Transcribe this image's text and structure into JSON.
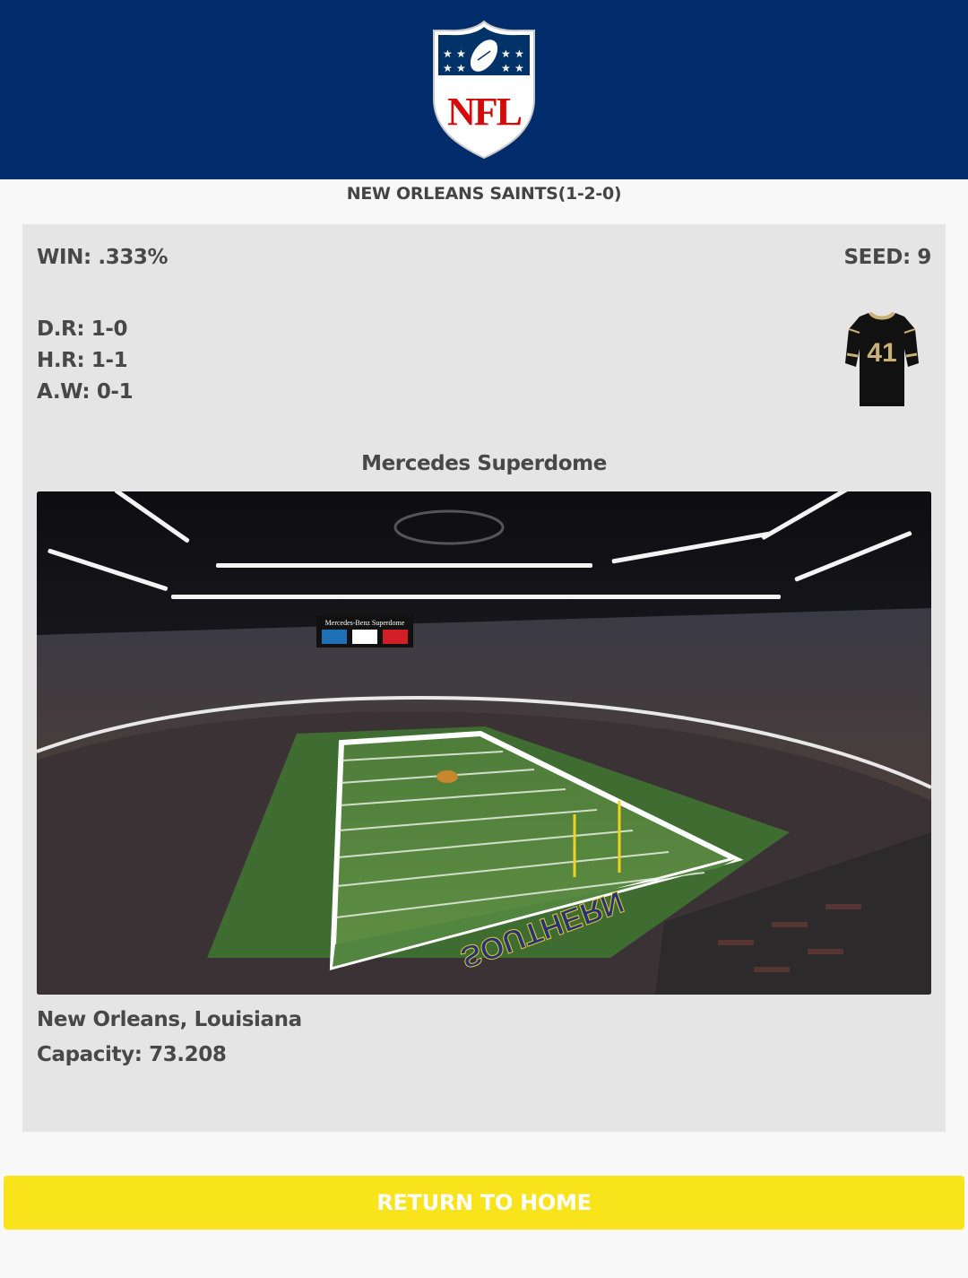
{
  "header": {
    "logo_text": "NFL",
    "primary_color": "#012c6b"
  },
  "team": {
    "title": "NEW ORLEANS SAINTS(1-2-0)",
    "win": "WIN: .333%",
    "seed": "SEED: 9",
    "division_record": "D.R: 1-0",
    "home_record": "H.R: 1-1",
    "away_record": "A.W: 0-1",
    "jersey_number": "41",
    "jersey_icon": "jersey-icon"
  },
  "stadium": {
    "name": "Mercedes Superdome",
    "location": "New Orleans, Louisiana",
    "capacity": "Capacity: 73.208",
    "scoreboard_text": "Mercedes-Benz Superdome",
    "endzone_text": "SOUTHERN"
  },
  "actions": {
    "return_home_label": "RETURN TO HOME",
    "button_color": "#f9e31a"
  }
}
